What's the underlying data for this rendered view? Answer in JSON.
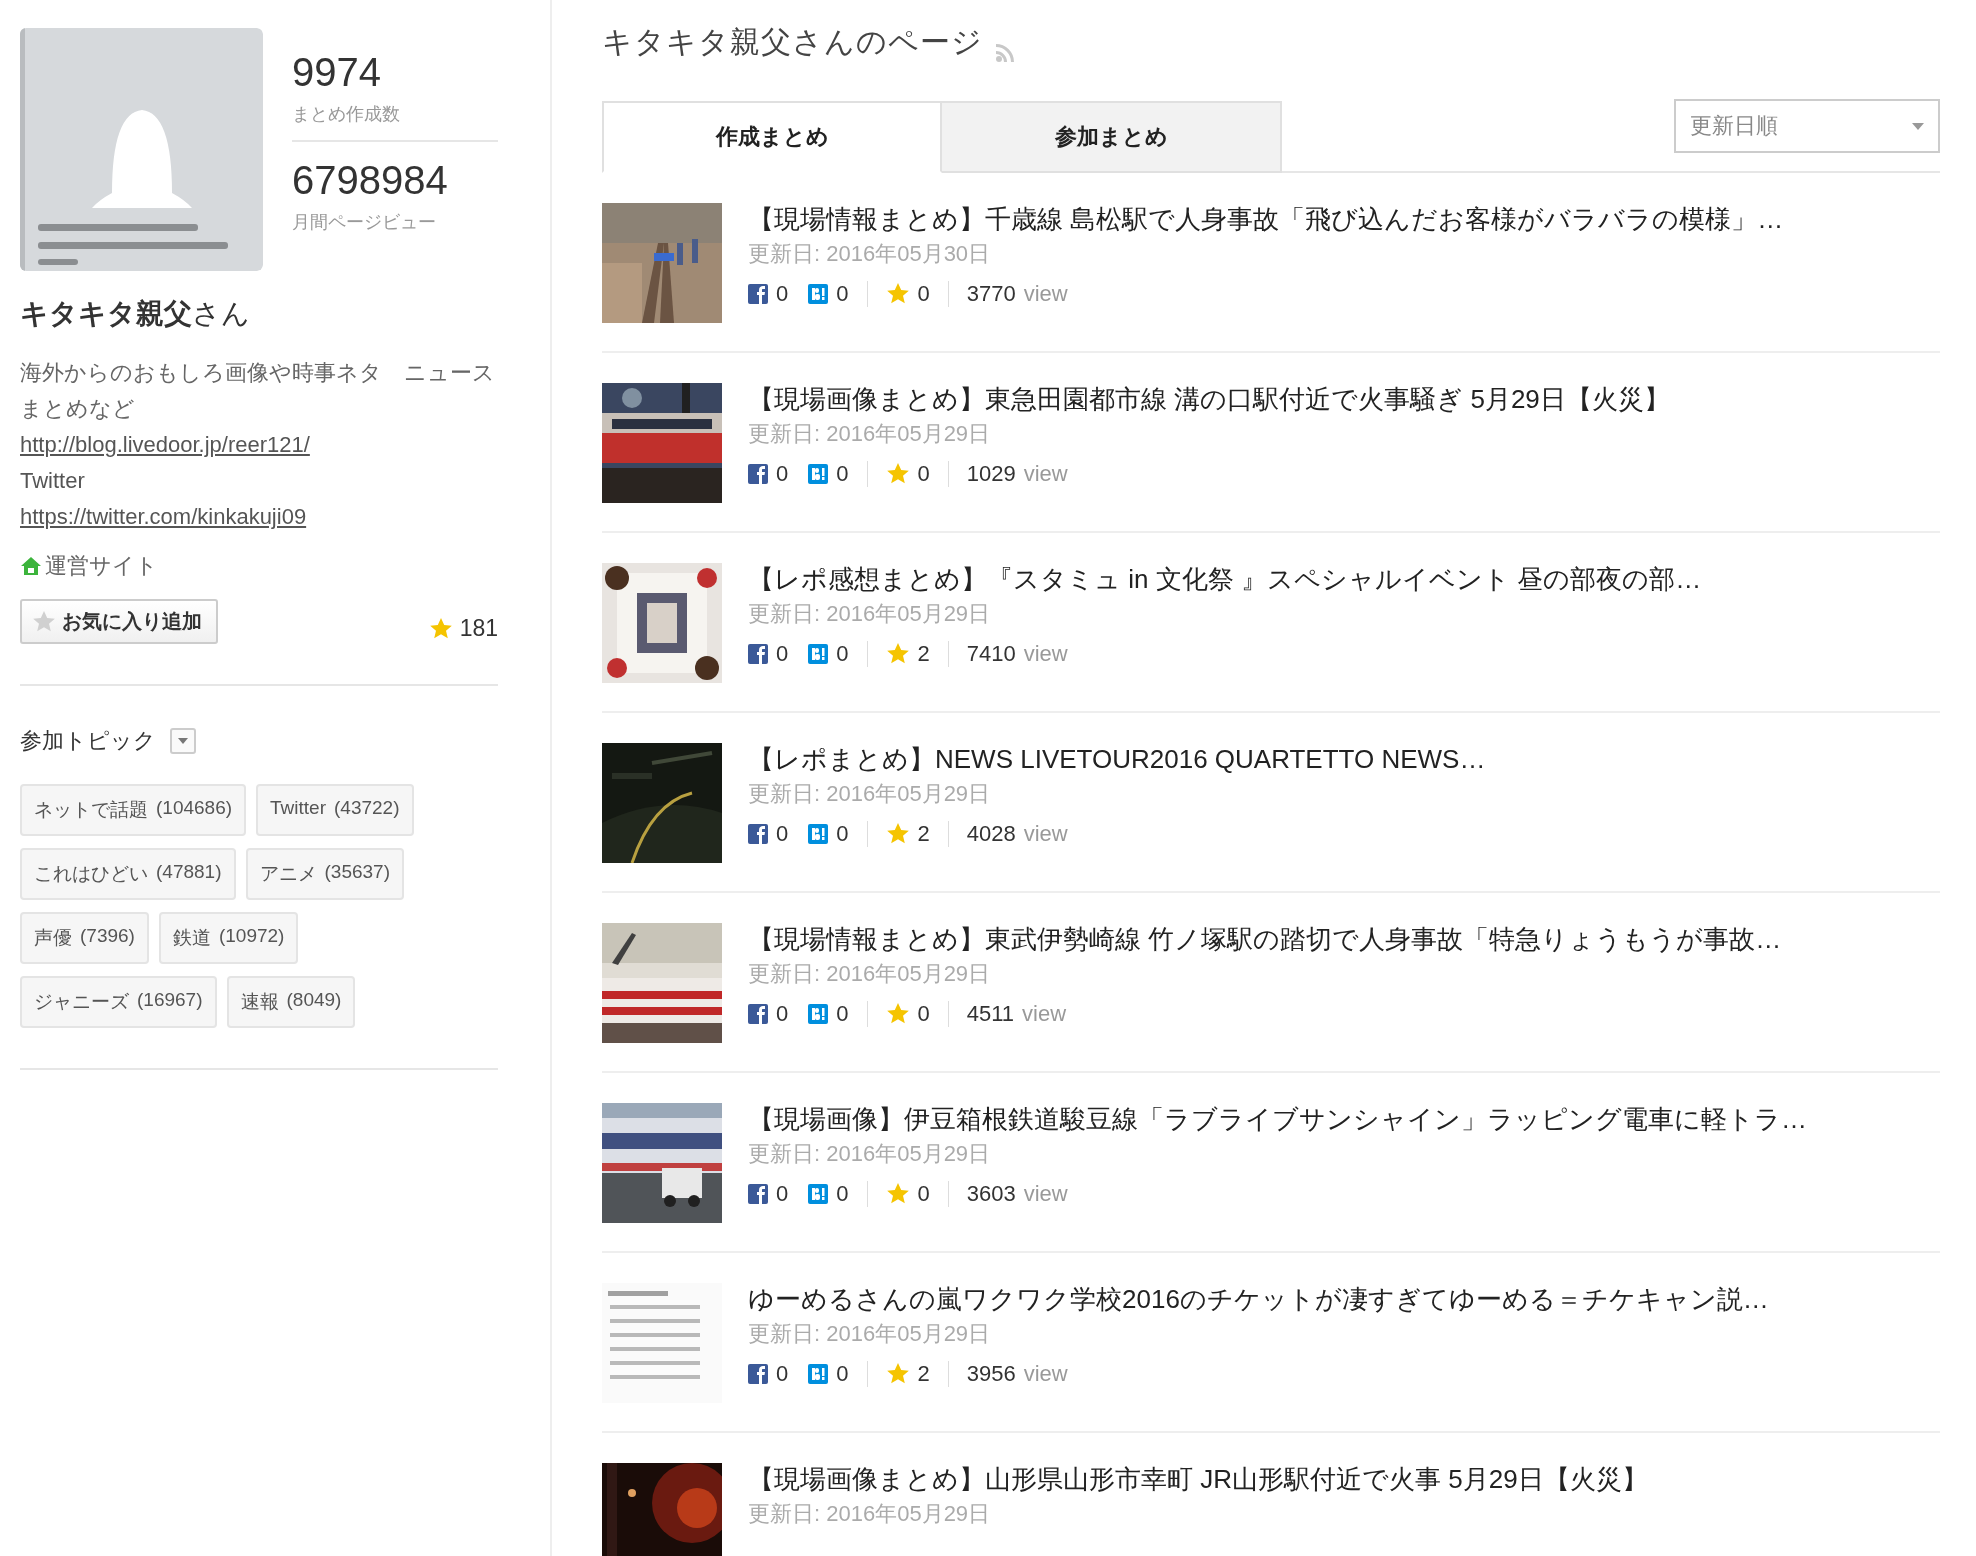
{
  "profile": {
    "stats": [
      {
        "value": "9974",
        "label": "まとめ作成数"
      },
      {
        "value": "6798984",
        "label": "月間ページビュー"
      }
    ],
    "name": "**キタキタ親父**さん",
    "description": "海外からのおもしろ画像や時事ネタ　ニュースまとめなど",
    "lines": [
      {
        "kind": "link",
        "text": "http://blog.livedoor.jp/reer121/"
      },
      {
        "kind": "text",
        "text": "Twitter"
      },
      {
        "kind": "link",
        "text": "https://twitter.com/kinkakuji09"
      }
    ],
    "site_link": "運営サイト",
    "favorite_button": "お気に入り追加",
    "favorite_count": "181"
  },
  "topics": {
    "title": "参加トピック",
    "expanded": false,
    "items": [
      {
        "name": "ネットで話題",
        "count": "(104686)"
      },
      {
        "name": "Twitter",
        "count": "(43722)"
      },
      {
        "name": "これはひどい",
        "count": "(47881)"
      },
      {
        "name": "アニメ",
        "count": "(35637)"
      },
      {
        "name": "声優",
        "count": "(7396)"
      },
      {
        "name": "鉄道",
        "count": "(10972)"
      },
      {
        "name": "ジャニーズ",
        "count": "(16967)"
      },
      {
        "name": "速報",
        "count": "(8049)"
      }
    ]
  },
  "page_title": "キタキタ親父さんのページ",
  "tabs": [
    {
      "label": "作成まとめ",
      "selected": true
    },
    {
      "label": "参加まとめ",
      "selected": false
    }
  ],
  "sort": {
    "value": "更新日順"
  },
  "items": [
    {
      "title": "【現場情報まとめ】千歳線 島松駅で人身事故「飛び込んだお客様がバラバラの模様」…",
      "date": "更新日: 2016年05月30日",
      "facebook": "0",
      "hatena": "0",
      "stars": "0",
      "views": "3770",
      "views_unit": "view"
    },
    {
      "title": "【現場画像まとめ】東急田園都市線 溝の口駅付近で火事騒ぎ 5月29日【火災】",
      "date": "更新日: 2016年05月29日",
      "facebook": "0",
      "hatena": "0",
      "stars": "0",
      "views": "1029",
      "views_unit": "view"
    },
    {
      "title": "【レポ感想まとめ】『スタミュ in 文化祭 』スペシャルイベント 昼の部夜の部…",
      "date": "更新日: 2016年05月29日",
      "facebook": "0",
      "hatena": "0",
      "stars": "2",
      "views": "7410",
      "views_unit": "view"
    },
    {
      "title": "【レポまとめ】NEWS LIVETOUR2016 QUARTETTO NEWS…",
      "date": "更新日: 2016年05月29日",
      "facebook": "0",
      "hatena": "0",
      "stars": "2",
      "views": "4028",
      "views_unit": "view"
    },
    {
      "title": "【現場情報まとめ】東武伊勢崎線 竹ノ塚駅の踏切で人身事故「特急りょうもうが事故…",
      "date": "更新日: 2016年05月29日",
      "facebook": "0",
      "hatena": "0",
      "stars": "0",
      "views": "4511",
      "views_unit": "view"
    },
    {
      "title": "【現場画像】伊豆箱根鉄道駿豆線「ラブライブサンシャイン」ラッピング電車に軽トラ…",
      "date": "更新日: 2016年05月29日",
      "facebook": "0",
      "hatena": "0",
      "stars": "0",
      "views": "3603",
      "views_unit": "view"
    },
    {
      "title": "ゆーめるさんの嵐ワクワク学校2016のチケットが凄すぎてゆーめる＝チケキャン説…",
      "date": "更新日: 2016年05月29日",
      "facebook": "0",
      "hatena": "0",
      "stars": "2",
      "views": "3956",
      "views_unit": "view"
    },
    {
      "title": "【現場画像まとめ】山形県山形市幸町 JR山形駅付近で火事 5月29日【火災】",
      "date": "更新日: 2016年05月29日"
    }
  ]
}
